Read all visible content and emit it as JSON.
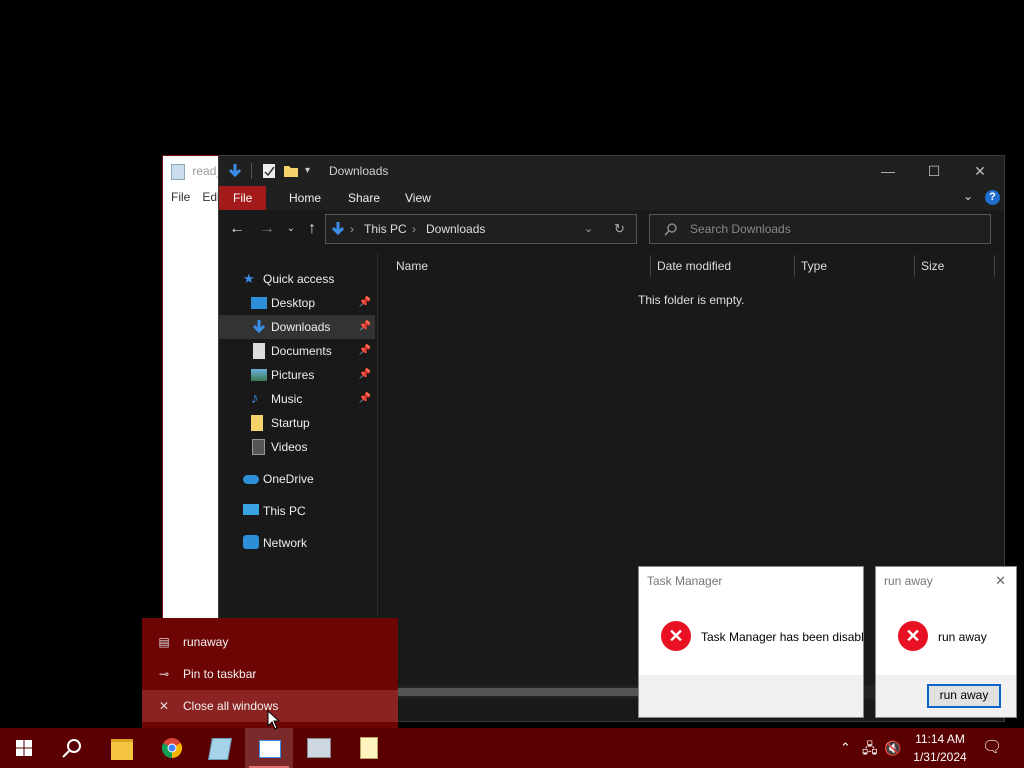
{
  "notepad": {
    "title": "read_",
    "menu": [
      "File",
      "Edi"
    ]
  },
  "explorer": {
    "title": "Downloads",
    "window_controls": {
      "minimize": "—",
      "maximize": "☐",
      "close": "✕"
    },
    "ribbon_tabs": [
      "File",
      "Home",
      "Share",
      "View"
    ],
    "address": {
      "crumbs": [
        "This PC",
        "Downloads"
      ]
    },
    "search": {
      "placeholder": "Search Downloads"
    },
    "nav": [
      {
        "label": "Quick access",
        "icon": "star-icon",
        "pinned": false
      },
      {
        "label": "Desktop",
        "icon": "desktop-icon",
        "pinned": true
      },
      {
        "label": "Downloads",
        "icon": "download-arrow-icon",
        "pinned": true,
        "selected": true
      },
      {
        "label": "Documents",
        "icon": "documents-icon",
        "pinned": true
      },
      {
        "label": "Pictures",
        "icon": "pictures-icon",
        "pinned": true
      },
      {
        "label": "Music",
        "icon": "music-icon",
        "pinned": true
      },
      {
        "label": "Startup",
        "icon": "folder-icon",
        "pinned": false
      },
      {
        "label": "Videos",
        "icon": "videos-icon",
        "pinned": false
      },
      {
        "label": "OneDrive",
        "icon": "cloud-icon",
        "pinned": false
      },
      {
        "label": "This PC",
        "icon": "computer-icon",
        "pinned": false
      },
      {
        "label": "Network",
        "icon": "network-icon",
        "pinned": false
      }
    ],
    "columns": [
      "Name",
      "Date modified",
      "Type",
      "Size"
    ],
    "empty_message": "This folder is empty."
  },
  "taskmgr_dialog": {
    "title": "Task Manager",
    "message": "Task Manager has been disable"
  },
  "runaway_dialog": {
    "title": "run away",
    "message": "run away",
    "button": "run away",
    "close": "✕"
  },
  "jumplist": {
    "items": [
      {
        "label": "runaway",
        "icon": "app-window-icon"
      },
      {
        "label": "Pin to taskbar",
        "icon": "pin-icon"
      },
      {
        "label": "Close all windows",
        "icon": "close-icon"
      }
    ]
  },
  "taskbar": {
    "apps": [
      "start-icon",
      "search-icon",
      "file-explorer-icon",
      "chrome-icon",
      "notepad-icon",
      "runaway-app-icon",
      "control-panel-icon",
      "notepad-file-icon"
    ],
    "clock": {
      "time": "11:14 AM",
      "date": "1/31/2024"
    }
  },
  "colors": {
    "accent": "#a31a1a",
    "taskbar": "#5a0000",
    "jumplist": "#6e0505"
  }
}
